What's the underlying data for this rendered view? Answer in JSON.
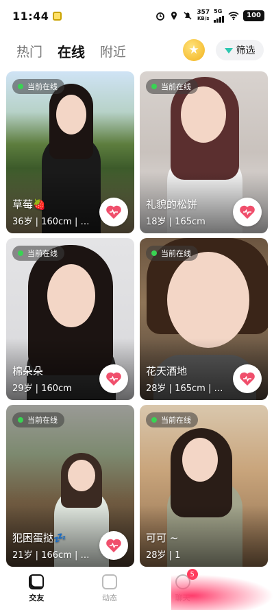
{
  "status_bar": {
    "time": "11:44",
    "net_speed_value": "357",
    "net_speed_unit": "KB/s",
    "network": "5G",
    "battery": "100"
  },
  "top_tabs": [
    "热门",
    "在线",
    "附近"
  ],
  "active_tab": "在线",
  "filter_label": "筛选",
  "online_badge": "当前在线",
  "cards": [
    {
      "name": "草莓🍓",
      "info": "36岁 | 160cm | …"
    },
    {
      "name": "礼貌的松饼",
      "info": "18岁 | 165cm"
    },
    {
      "name": "棉朵朵",
      "info": "29岁 | 160cm"
    },
    {
      "name": "花天酒地",
      "info": "28岁 | 165cm | …"
    },
    {
      "name": "犯困蛋挞💤",
      "info": "21岁 | 166cm | …"
    },
    {
      "name": "可可 ~",
      "info": "28岁 | 1"
    }
  ],
  "bottom_nav": {
    "items": [
      "交友",
      "动态",
      "聊天"
    ],
    "chat_badge": "5"
  },
  "colors": {
    "online_dot": "#39d353",
    "like_heart": "#f04f6c",
    "badge": "#ff3b5c",
    "filter_accent": "#2cc7b0"
  }
}
